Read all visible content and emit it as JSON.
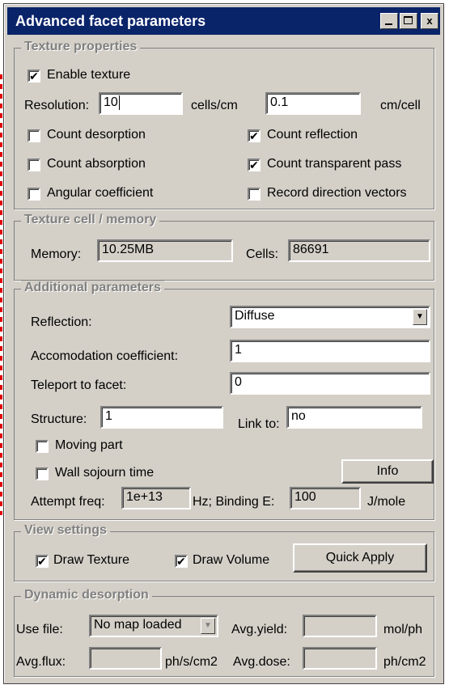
{
  "window": {
    "title": "Advanced facet parameters"
  },
  "texture_properties": {
    "legend": "Texture properties",
    "enable_texture": {
      "label": "Enable texture",
      "checked": true
    },
    "resolution_label": "Resolution:",
    "resolution_value": "10",
    "cells_unit": "cells/cm",
    "cm_value": "0.1",
    "cm_unit": "cm/cell",
    "count_desorption": {
      "label": "Count desorption",
      "checked": false
    },
    "count_reflection": {
      "label": "Count reflection",
      "checked": true
    },
    "count_absorption": {
      "label": "Count absorption",
      "checked": false
    },
    "count_transparent": {
      "label": "Count transparent pass",
      "checked": true
    },
    "angular_coefficient": {
      "label": "Angular coefficient",
      "checked": false
    },
    "record_direction": {
      "label": "Record direction vectors",
      "checked": false
    }
  },
  "texture_memory": {
    "legend": "Texture cell / memory",
    "memory_label": "Memory:",
    "memory_value": "10.25MB",
    "cells_label": "Cells:",
    "cells_value": "86691"
  },
  "additional": {
    "legend": "Additional parameters",
    "reflection_label": "Reflection:",
    "reflection_value": "Diffuse",
    "accom_label": "Accomodation coefficient:",
    "accom_value": "1",
    "teleport_label": "Teleport to facet:",
    "teleport_value": "0",
    "structure_label": "Structure:",
    "structure_value": "1",
    "link_label": "Link to:",
    "link_value": "no",
    "moving_part": {
      "label": "Moving part",
      "checked": false
    },
    "wall_sojourn": {
      "label": "Wall sojourn time",
      "checked": false
    },
    "info_button": "Info",
    "attempt_label": "Attempt freq:",
    "attempt_value": "1e+13",
    "hz_label": "Hz; Binding E:",
    "binding_value": "100",
    "jmole_label": "J/mole"
  },
  "view_settings": {
    "legend": "View settings",
    "draw_texture": {
      "label": "Draw Texture",
      "checked": true
    },
    "draw_volume": {
      "label": "Draw Volume",
      "checked": true
    },
    "quick_apply": "Quick Apply"
  },
  "dynamic": {
    "legend": "Dynamic desorption",
    "use_file_label": "Use file:",
    "use_file_value": "No map loaded",
    "avg_yield_label": "Avg.yield:",
    "avg_yield_value": "",
    "molph_label": "mol/ph",
    "avg_flux_label": "Avg.flux:",
    "avg_flux_value": "",
    "flux_unit": "ph/s/cm2",
    "avg_dose_label": "Avg.dose:",
    "avg_dose_value": "",
    "dose_unit": "ph/cm2"
  },
  "check_glyph": "✔",
  "icons": {
    "minimize": "minimize-icon",
    "maximize": "maximize-icon",
    "close": "close-icon",
    "dropdown": "chevron-down-icon"
  }
}
